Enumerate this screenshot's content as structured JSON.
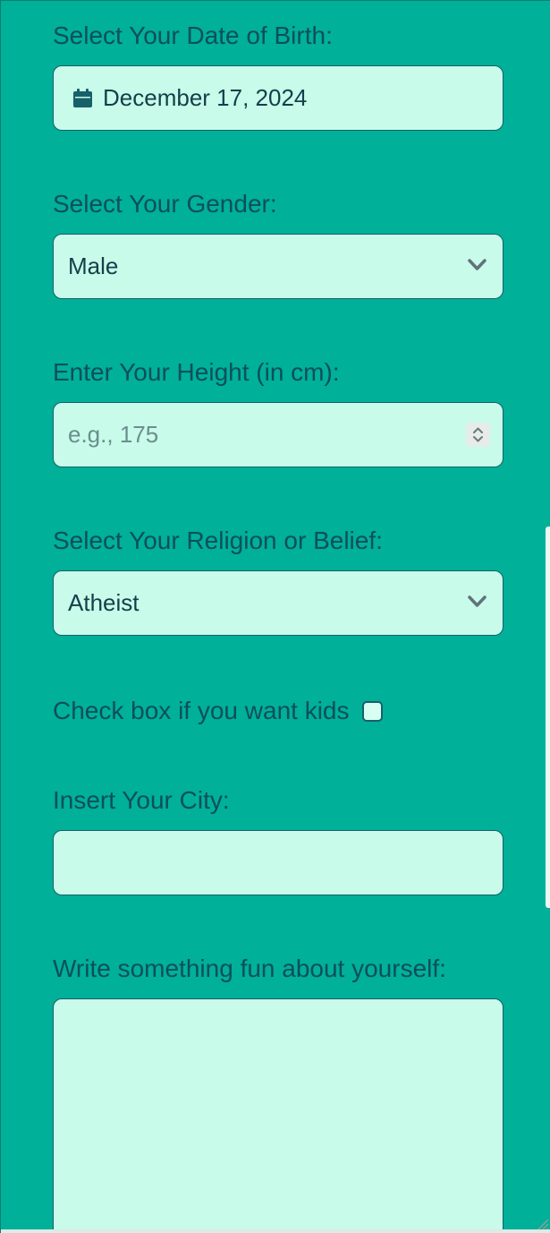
{
  "form": {
    "birth_label": "Select Your Date of Birth:",
    "birth_value": "December 17, 2024",
    "gender_label": "Select Your Gender:",
    "gender_value": "Male",
    "height_label": "Enter Your Height (in cm):",
    "height_placeholder": "e.g., 175",
    "religion_label": "Select Your Religion or Belief:",
    "religion_value": "Atheist",
    "kids_label": "Check box if you want kids",
    "kids_checked": false,
    "city_label": "Insert Your City:",
    "city_value": "",
    "fun_label": "Write something fun about yourself:",
    "fun_value": ""
  },
  "icons": {
    "calendar": "calendar-icon",
    "dropdown": "chevron-down-icon",
    "number_stepper": "up-down-spinner-icon",
    "resize": "resize-grip-icon"
  },
  "colors": {
    "background": "#00b098",
    "field_fill": "#c8fbe9",
    "text": "#0d4f5c",
    "border": "#17606a"
  }
}
